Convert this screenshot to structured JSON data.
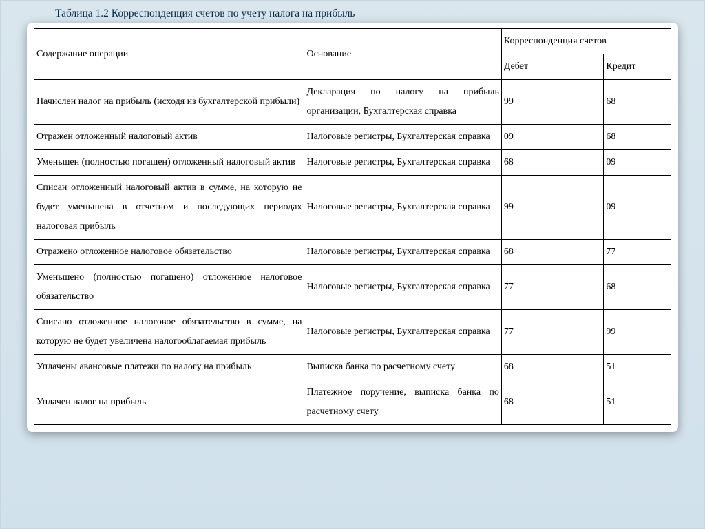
{
  "title": "Таблица 1.2 Корреспонденция счетов по учету налога на прибыль",
  "headers": {
    "operation": "Содержание операции",
    "basis": "Основание",
    "correspondence": "Корреспонденция счетов",
    "debit": "Дебет",
    "credit": "Кредит"
  },
  "rows": [
    {
      "operation": "Начислен налог на прибыль (исходя из бухгалтерской прибыли)",
      "basis": "Декларация по налогу на прибыль организации, Бухгалтерская справка",
      "debit": "99",
      "credit": "68"
    },
    {
      "operation": "Отражен отложенный налоговый актив",
      "basis": "Налоговые регистры, Бухгалтерская справка",
      "debit": "09",
      "credit": "68"
    },
    {
      "operation": "Уменьшен (полностью погашен) отложенный налоговый актив",
      "basis": "Налоговые регистры, Бухгалтерская справка",
      "debit": "68",
      "credit": "09"
    },
    {
      "operation": "Списан отложенный налоговый актив в сумме, на которую не будет уменьшена в отчетном и последующих периодах налоговая прибыль",
      "basis": "Налоговые регистры, Бухгалтерская справка",
      "debit": "99",
      "credit": "09"
    },
    {
      "operation": "Отражено отложенное налоговое обязательство",
      "basis": "Налоговые регистры, Бухгалтерская справка",
      "debit": "68",
      "credit": "77"
    },
    {
      "operation": "Уменьшено (полностью погашено) отложенное налоговое обязательство",
      "basis": "Налоговые регистры, Бухгалтерская справка",
      "debit": "77",
      "credit": "68"
    },
    {
      "operation": "Списано отложенное налоговое обязательство в сумме, на которую не будет увеличена налогооблагаемая прибыль",
      "basis": "Налоговые регистры, Бухгалтерская справка",
      "debit": "77",
      "credit": "99"
    },
    {
      "operation": "Уплачены авансовые платежи по налогу на прибыль",
      "basis": "Выписка банка по расчетному счету",
      "debit": "68",
      "credit": "51"
    },
    {
      "operation": "Уплачен налог на прибыль",
      "basis": "Платежное поручение, выписка банка по расчетному счету",
      "debit": "68",
      "credit": "51"
    }
  ]
}
